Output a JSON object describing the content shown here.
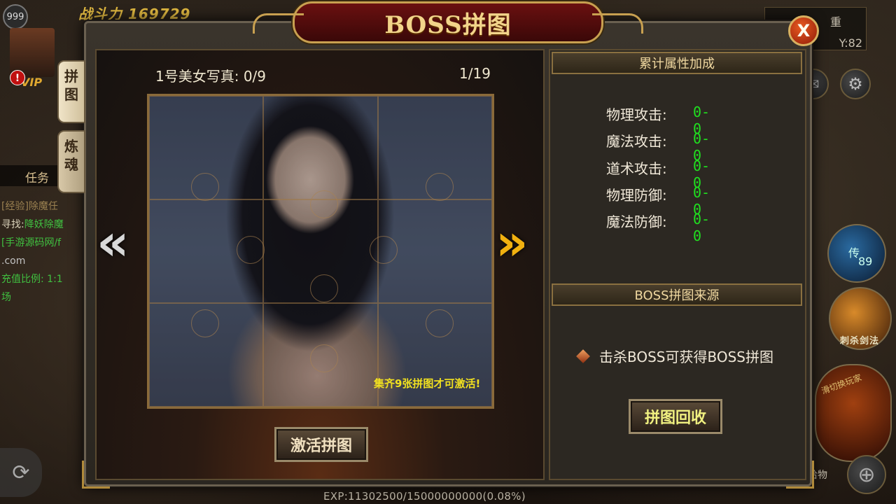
{
  "hud": {
    "level": "999",
    "power_label": "战斗力",
    "power_value": "169729",
    "vip": "VIP",
    "coord_top": "重",
    "coord": "Y:82",
    "teleport_label": "传",
    "teleport_count": "89",
    "skill_label": "刺杀剑法",
    "switch_label": "滑切换玩家",
    "pick_label": "拾物",
    "exp": "EXP:11302500/15000000000(0.08%)"
  },
  "quest": {
    "tab_label": "任务",
    "exp_line": "[经验]除魔任",
    "find_prefix": "寻找:",
    "find_target": "降妖除魔",
    "site_line": "[手游源码网/f",
    "site_line2": ".com",
    "ratio_line": "充值比例: 1:1",
    "scene_line": "场"
  },
  "dialog": {
    "title": "BOSS拼图",
    "close_symbol": "X",
    "tabs": [
      {
        "label": "拼图",
        "active": true
      },
      {
        "label": "炼魂",
        "active": false
      }
    ],
    "puzzle": {
      "set_name": "1号美女写真: 0/9",
      "page": "1/19",
      "hint": "集齐9张拼图才可激活!",
      "pieces_total": 9,
      "pieces_collected": 0
    },
    "activate_button": "激活拼图",
    "attr_section_title": "累计属性加成",
    "attributes": [
      {
        "name": "物理攻击:",
        "value": "0-0"
      },
      {
        "name": "魔法攻击:",
        "value": "0-0"
      },
      {
        "name": "道术攻击:",
        "value": "0-0"
      },
      {
        "name": "物理防御:",
        "value": "0-0"
      },
      {
        "name": "魔法防御:",
        "value": "0-0"
      }
    ],
    "source_section_title": "BOSS拼图来源",
    "source_text": "击杀BOSS可获得BOSS拼图",
    "recycle_button": "拼图回收"
  },
  "colors": {
    "attr_value": "#20e020",
    "hint": "#f0e020",
    "arrow_right": "#f0b010",
    "title": "#f2d48a"
  }
}
